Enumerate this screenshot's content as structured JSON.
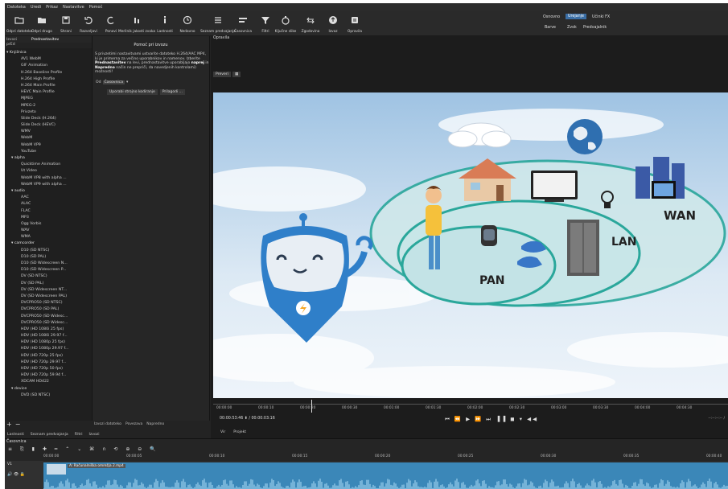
{
  "menu": [
    "Datoteka",
    "Uredi",
    "Prikaz",
    "Nastavitve",
    "Pomoč"
  ],
  "toolbar": [
    {
      "label": "Odpri datoteko",
      "icon": "folder-open-icon"
    },
    {
      "label": "Odpri drugo",
      "icon": "folder-icon"
    },
    {
      "label": "Shrani",
      "icon": "save-icon"
    },
    {
      "label": "Razveljavi",
      "icon": "undo-icon"
    },
    {
      "label": "Ponovi",
      "icon": "redo-icon"
    },
    {
      "label": "Merilnik jakosti zvoka",
      "icon": "meter-icon"
    },
    {
      "label": "Lastnosti",
      "icon": "info-icon"
    },
    {
      "label": "Nedavno",
      "icon": "clock-icon"
    },
    {
      "label": "Seznam predvajanja",
      "icon": "list-icon"
    },
    {
      "label": "Časovnica",
      "icon": "timeline-icon"
    },
    {
      "label": "Filtri",
      "icon": "filter-icon"
    },
    {
      "label": "Ključne slike",
      "icon": "stopwatch-icon"
    },
    {
      "label": "Zgodovina",
      "icon": "history-icon"
    },
    {
      "label": "Izvoz",
      "icon": "export-icon"
    },
    {
      "label": "Opravila",
      "icon": "jobs-icon"
    }
  ],
  "layouts": {
    "top": [
      "Osnovno",
      "Urejanje",
      "Učinki FX"
    ],
    "bottom": [
      "Barve",
      "Zvok",
      "Predvajalnik"
    ],
    "active": "Urejanje"
  },
  "left_panel": {
    "tabs": [
      "Izvozi",
      "Prednastavitev"
    ],
    "title": "prEd",
    "presets": [
      {
        "t": "Knjižnica",
        "l": "root"
      },
      {
        "t": "AV1 WebM",
        "l": "sub"
      },
      {
        "t": "GIF Animation",
        "l": "sub"
      },
      {
        "t": "H.264 Baseline Profile",
        "l": "sub"
      },
      {
        "t": "H.264 High Profile",
        "l": "sub"
      },
      {
        "t": "H.264 Main Profile",
        "l": "sub"
      },
      {
        "t": "HEVC Main Profile",
        "l": "sub"
      },
      {
        "t": "MJPEG",
        "l": "sub"
      },
      {
        "t": "MPEG-2",
        "l": "sub"
      },
      {
        "t": "Privzeto",
        "l": "sub"
      },
      {
        "t": "Slide Deck (H.264)",
        "l": "sub"
      },
      {
        "t": "Slide Deck (HEVC)",
        "l": "sub"
      },
      {
        "t": "WMV",
        "l": "sub"
      },
      {
        "t": "WebM",
        "l": "sub"
      },
      {
        "t": "WebM VP9",
        "l": "sub"
      },
      {
        "t": "YouTube",
        "l": "sub"
      },
      {
        "t": "alpha",
        "l": "cat"
      },
      {
        "t": "Quicktime Animation",
        "l": "sub"
      },
      {
        "t": "Ut Video",
        "l": "sub"
      },
      {
        "t": "WebM VP8 with alpha ...",
        "l": "sub"
      },
      {
        "t": "WebM VP9 with alpha ...",
        "l": "sub"
      },
      {
        "t": "audio",
        "l": "cat"
      },
      {
        "t": "AAC",
        "l": "sub"
      },
      {
        "t": "ALAC",
        "l": "sub"
      },
      {
        "t": "FLAC",
        "l": "sub"
      },
      {
        "t": "MP3",
        "l": "sub"
      },
      {
        "t": "Ogg Vorbis",
        "l": "sub"
      },
      {
        "t": "WAV",
        "l": "sub"
      },
      {
        "t": "WMA",
        "l": "sub"
      },
      {
        "t": "camcorder",
        "l": "cat"
      },
      {
        "t": "D10 (SD NTSC)",
        "l": "sub"
      },
      {
        "t": "D10 (SD PAL)",
        "l": "sub"
      },
      {
        "t": "D10 (SD Widescreen N...",
        "l": "sub"
      },
      {
        "t": "D10 (SD Widescreen P...",
        "l": "sub"
      },
      {
        "t": "DV (SD NTSC)",
        "l": "sub"
      },
      {
        "t": "DV (SD PAL)",
        "l": "sub"
      },
      {
        "t": "DV (SD Widescreen NT...",
        "l": "sub"
      },
      {
        "t": "DV (SD Widescreen PAL)",
        "l": "sub"
      },
      {
        "t": "DVCPRO50 (SD NTSC)",
        "l": "sub"
      },
      {
        "t": "DVCPRO50 (SD PAL)",
        "l": "sub"
      },
      {
        "t": "DVCPRO50 (SD Widesc...",
        "l": "sub"
      },
      {
        "t": "DVCPRO50 (SD Widesc...",
        "l": "sub"
      },
      {
        "t": "HDV (HD 1080i 25 fps)",
        "l": "sub"
      },
      {
        "t": "HDV (HD 1080i 29.97 f...",
        "l": "sub"
      },
      {
        "t": "HDV (HD 1080p 25 fps)",
        "l": "sub"
      },
      {
        "t": "HDV (HD 1080p 29.97 f...",
        "l": "sub"
      },
      {
        "t": "HDV (HD 720p 25 fps)",
        "l": "sub"
      },
      {
        "t": "HDV (HD 720p 29.97 f...",
        "l": "sub"
      },
      {
        "t": "HDV (HD 720p 50 fps)",
        "l": "sub"
      },
      {
        "t": "HDV (HD 720p 59.94 f...",
        "l": "sub"
      },
      {
        "t": "XDCAM HD422",
        "l": "sub"
      },
      {
        "t": "device",
        "l": "cat"
      },
      {
        "t": "DVD (SD NTSC)",
        "l": "sub"
      }
    ],
    "buttons": [
      "+",
      "−"
    ]
  },
  "mid_panel": {
    "title": "Pomoč pri izvozu",
    "text_pre": "S privzetimi nastavitvami ustvarite datoteko H.264/AAC MP4, ki je primerna za večino uporabnikov in namenov. Izberite ",
    "text_b1": "Prednastavitev",
    "text_mid": " na levi, prednastavitve uporabljajo ",
    "text_b2": "naprej",
    "text_mid2": " in ",
    "text_b3": "Napredno",
    "text_post": " način ne prepriči, da navedjenih kontrolami) možnosti!",
    "filter_label": "Od",
    "filter_value": "Časovnica",
    "buttons": [
      "Uporabi strojno kodiranje",
      "Prilagodi ..."
    ],
    "bottom_tabs": [
      "Izvozi datoteko",
      "Povezava",
      "Napredno"
    ]
  },
  "bottom_tabs": [
    "Lastnosti",
    "Seznam predvajanja",
    "Filtri",
    "Izvozi"
  ],
  "player": {
    "title": "Opravila",
    "tool": "Preveri",
    "timecode": "00:00:53:46",
    "duration": "00:00:03:16",
    "ruler": [
      "00:00:00",
      "00:00:10",
      "00:00:20",
      "00:00:30",
      "00:01:00",
      "00:01:30",
      "00:02:00",
      "00:02:30",
      "00:03:00",
      "00:03:30",
      "00:04:00",
      "00:04:30"
    ],
    "tabs": [
      "Vir",
      "Projekt"
    ],
    "right_ts": "--:--:--:-- /"
  },
  "image_labels": {
    "pan": "PAN",
    "lan": "LAN",
    "wan": "WAN"
  },
  "timeline": {
    "title": "Časovnica",
    "ruler": [
      "00:00:00",
      "00:00:05",
      "00:00:10",
      "00:00:15",
      "00:00:20",
      "00:00:25",
      "00:00:30",
      "00:00:35",
      "00:00:40"
    ],
    "track_label": "V1",
    "clip_label": "A: Računalniška omrežja 2.mp4"
  }
}
